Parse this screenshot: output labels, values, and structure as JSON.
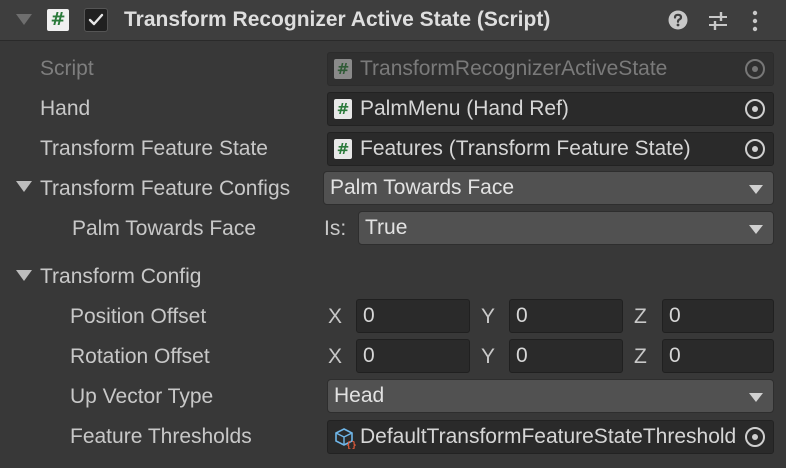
{
  "header": {
    "title": "Transform Recognizer Active State (Script)",
    "enabled": true
  },
  "fields": {
    "script": {
      "label": "Script",
      "value": "TransformRecognizerActiveState"
    },
    "hand": {
      "label": "Hand",
      "value": "PalmMenu (Hand Ref)"
    },
    "transform_feature_state": {
      "label": "Transform Feature State",
      "value": "Features (Transform Feature State)"
    },
    "transform_feature_configs": {
      "label": "Transform Feature Configs",
      "value": "Palm Towards Face"
    },
    "palm_towards_face": {
      "label": "Palm Towards Face",
      "is_label": "Is:",
      "value": "True"
    },
    "transform_config": {
      "label": "Transform Config"
    },
    "position_offset": {
      "label": "Position Offset",
      "x": "0",
      "y": "0",
      "z": "0"
    },
    "rotation_offset": {
      "label": "Rotation Offset",
      "x": "0",
      "y": "0",
      "z": "0"
    },
    "up_vector_type": {
      "label": "Up Vector Type",
      "value": "Head"
    },
    "feature_thresholds": {
      "label": "Feature Thresholds",
      "value": "DefaultTransformFeatureStateThresholds"
    }
  },
  "axes": {
    "x": "X",
    "y": "Y",
    "z": "Z"
  },
  "icons": {
    "script": "hash-icon",
    "help": "help-icon",
    "presets": "sliders-icon",
    "menu": "kebab-icon",
    "asset": "scriptable-object-icon",
    "picker": "object-picker-icon"
  },
  "colors": {
    "background": "#383838",
    "header": "#3e3e3e",
    "field": "#2a2a2a",
    "dropdown": "#515151",
    "script_icon_green": "#2a7a3a"
  }
}
